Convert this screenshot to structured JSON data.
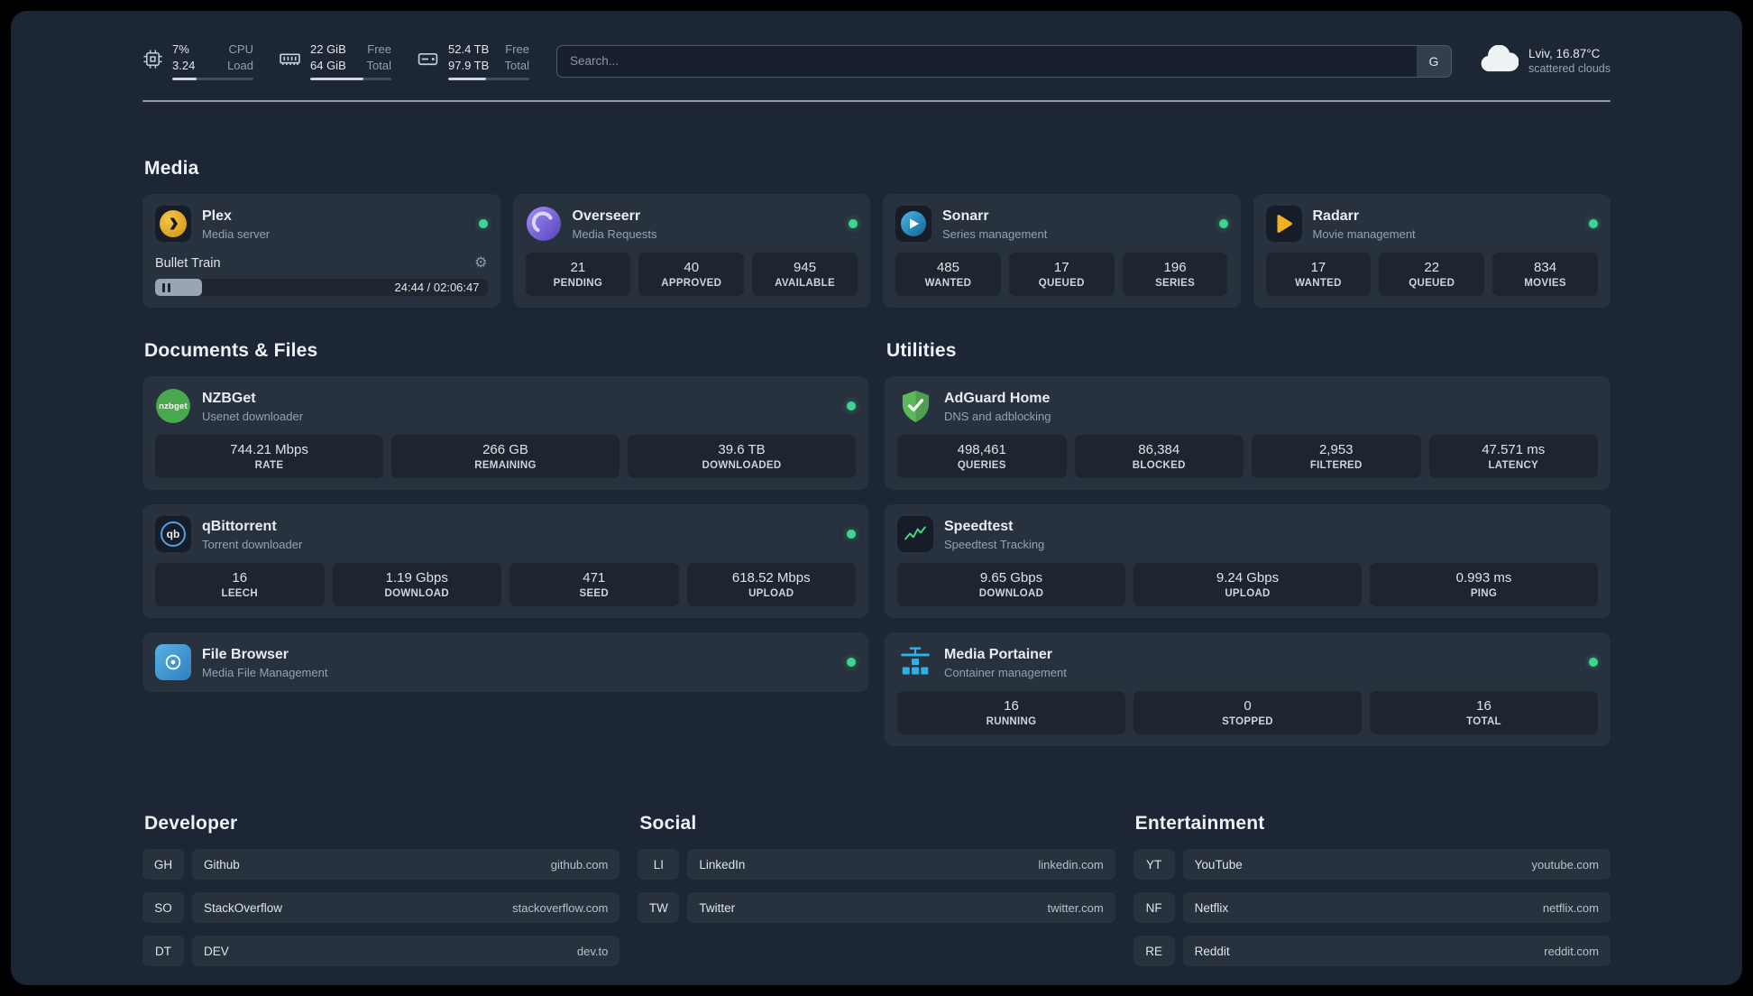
{
  "colors": {
    "status_green": "#3ed58c",
    "accent_plex": "#e5a00d",
    "accent_overseerr": "#6c5ce7",
    "accent_sonarr": "#35a7e0",
    "accent_radarr": "#f2b11e",
    "accent_nzbget": "#4aa94f",
    "accent_qbittorrent": "#4ca3e0",
    "accent_filebrowser": "#3f93cf",
    "accent_adguard": "#5cb85c",
    "accent_speedtest": "#3ddc84",
    "accent_portainer": "#2fb1e8"
  },
  "sections": {
    "media": "Media",
    "documents": "Documents & Files",
    "utilities": "Utilities",
    "developer": "Developer",
    "social": "Social",
    "entertainment": "Entertainment"
  },
  "topbar": {
    "resources": [
      {
        "name": "cpu",
        "value_top": "7%",
        "label_top": "CPU",
        "value_bottom": "3.24",
        "label_bottom": "Load",
        "progress_pct": 30
      },
      {
        "name": "memory",
        "value_top": "22 GiB",
        "label_top": "Free",
        "value_bottom": "64 GiB",
        "label_bottom": "Total",
        "progress_pct": 66
      },
      {
        "name": "disk",
        "value_top": "52.4 TB",
        "label_top": "Free",
        "value_bottom": "97.9 TB",
        "label_bottom": "Total",
        "progress_pct": 47
      }
    ],
    "search": {
      "placeholder": "Search...",
      "button_label": "G"
    },
    "weather": {
      "location_temp": "Lviv, 16.87°C",
      "condition": "scattered clouds"
    }
  },
  "apps": {
    "plex": {
      "name": "Plex",
      "subtitle": "Media server",
      "player": {
        "title": "Bullet Train",
        "time": "24:44 / 02:06:47",
        "progress_pct": 14
      }
    },
    "overseerr": {
      "name": "Overseerr",
      "subtitle": "Media Requests",
      "stats": [
        {
          "value": "21",
          "label": "PENDING"
        },
        {
          "value": "40",
          "label": "APPROVED"
        },
        {
          "value": "945",
          "label": "AVAILABLE"
        }
      ]
    },
    "sonarr": {
      "name": "Sonarr",
      "subtitle": "Series management",
      "stats": [
        {
          "value": "485",
          "label": "WANTED"
        },
        {
          "value": "17",
          "label": "QUEUED"
        },
        {
          "value": "196",
          "label": "SERIES"
        }
      ]
    },
    "radarr": {
      "name": "Radarr",
      "subtitle": "Movie management",
      "stats": [
        {
          "value": "17",
          "label": "WANTED"
        },
        {
          "value": "22",
          "label": "QUEUED"
        },
        {
          "value": "834",
          "label": "MOVIES"
        }
      ]
    },
    "nzbget": {
      "name": "NZBGet",
      "subtitle": "Usenet downloader",
      "icon_text": "nzbget",
      "stats": [
        {
          "value": "744.21 Mbps",
          "label": "RATE"
        },
        {
          "value": "266 GB",
          "label": "REMAINING"
        },
        {
          "value": "39.6 TB",
          "label": "DOWNLOADED"
        }
      ]
    },
    "qbittorrent": {
      "name": "qBittorrent",
      "subtitle": "Torrent downloader",
      "icon_text": "qb",
      "stats": [
        {
          "value": "16",
          "label": "LEECH"
        },
        {
          "value": "1.19 Gbps",
          "label": "DOWNLOAD"
        },
        {
          "value": "471",
          "label": "SEED"
        },
        {
          "value": "618.52 Mbps",
          "label": "UPLOAD"
        }
      ]
    },
    "filebrowser": {
      "name": "File Browser",
      "subtitle": "Media File Management"
    },
    "adguard": {
      "name": "AdGuard Home",
      "subtitle": "DNS and adblocking",
      "stats": [
        {
          "value": "498,461",
          "label": "QUERIES"
        },
        {
          "value": "86,384",
          "label": "BLOCKED"
        },
        {
          "value": "2,953",
          "label": "FILTERED"
        },
        {
          "value": "47.571 ms",
          "label": "LATENCY"
        }
      ]
    },
    "speedtest": {
      "name": "Speedtest",
      "subtitle": "Speedtest Tracking",
      "stats": [
        {
          "value": "9.65 Gbps",
          "label": "DOWNLOAD"
        },
        {
          "value": "9.24 Gbps",
          "label": "UPLOAD"
        },
        {
          "value": "0.993 ms",
          "label": "PING"
        }
      ]
    },
    "portainer": {
      "name": "Media Portainer",
      "subtitle": "Container management",
      "stats": [
        {
          "value": "16",
          "label": "RUNNING"
        },
        {
          "value": "0",
          "label": "STOPPED"
        },
        {
          "value": "16",
          "label": "TOTAL"
        }
      ]
    }
  },
  "bookmarks": {
    "developer": [
      {
        "abbr": "GH",
        "name": "Github",
        "domain": "github.com"
      },
      {
        "abbr": "SO",
        "name": "StackOverflow",
        "domain": "stackoverflow.com"
      },
      {
        "abbr": "DT",
        "name": "DEV",
        "domain": "dev.to"
      }
    ],
    "social": [
      {
        "abbr": "LI",
        "name": "LinkedIn",
        "domain": "linkedin.com"
      },
      {
        "abbr": "TW",
        "name": "Twitter",
        "domain": "twitter.com"
      }
    ],
    "entertainment": [
      {
        "abbr": "YT",
        "name": "YouTube",
        "domain": "youtube.com"
      },
      {
        "abbr": "NF",
        "name": "Netflix",
        "domain": "netflix.com"
      },
      {
        "abbr": "RE",
        "name": "Reddit",
        "domain": "reddit.com"
      }
    ]
  }
}
